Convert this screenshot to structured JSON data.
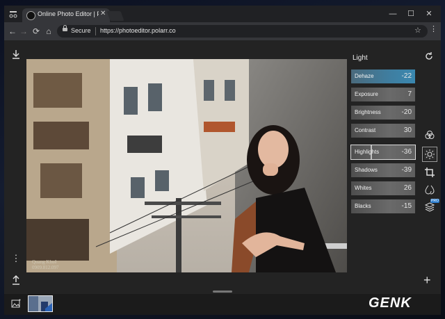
{
  "browser": {
    "tab_title": "Online Photo Editor | Pol",
    "tab_close": "✕",
    "secure_label": "Secure",
    "url": "https://photoeditor.polarr.co",
    "window_controls": [
      "—",
      "☐",
      "✕"
    ],
    "nav": [
      "←",
      "→",
      "⟳",
      "⌂"
    ]
  },
  "photo": {
    "watermark_name": "Quang Khuê",
    "watermark_phone": "0909.812.097"
  },
  "panel": {
    "title": "Light",
    "sliders": [
      {
        "label": "Dehaze",
        "value": "-22"
      },
      {
        "label": "Exposure",
        "value": "7"
      },
      {
        "label": "Brightness",
        "value": "-20"
      },
      {
        "label": "Contrast",
        "value": "30"
      },
      {
        "label": "Highlights",
        "value": "-36"
      },
      {
        "label": "Shadows",
        "value": "-39"
      },
      {
        "label": "Whites",
        "value": "26"
      },
      {
        "label": "Blacks",
        "value": "-15"
      }
    ],
    "tools": [
      "color-icon",
      "light-icon",
      "crop-icon",
      "retouch-icon",
      "layers-icon"
    ],
    "pro_badge": "PRO"
  },
  "brand_logo": "GENK",
  "colors": {
    "accent": "#3a88b0",
    "panel_bg": "#232323",
    "browser_bg": "#202124"
  }
}
